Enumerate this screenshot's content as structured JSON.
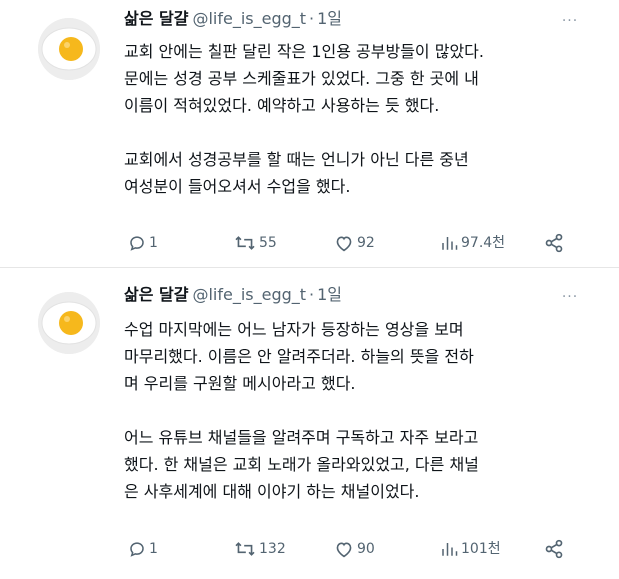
{
  "tweets": [
    {
      "display_name": "삶은 달걀",
      "handle": "@life_is_egg_t",
      "separator": "·",
      "time": "1일",
      "more_label": "···",
      "body_lines": [
        "교회 안에는 칠판 달린 작은 1인용 공부방들이 많았다.",
        "문에는 성경 공부 스케줄표가 있었다. 그중 한 곳에 내",
        "이름이 적혀있었다. 예약하고 사용하는 듯 했다.",
        "",
        "교회에서 성경공부를 할 때는 언니가 아닌 다른 중년",
        "여성분이 들어오셔서 수업을 했다."
      ],
      "stats": {
        "replies": "1",
        "retweets": "55",
        "likes": "92",
        "views": "97.4천"
      }
    },
    {
      "display_name": "삶은 달걀",
      "handle": "@life_is_egg_t",
      "separator": "·",
      "time": "1일",
      "more_label": "···",
      "body_lines": [
        "수업 마지막에는 어느 남자가 등장하는 영상을 보며",
        "마무리했다. 이름은 안 알려주더라. 하늘의 뜻을 전하",
        "며 우리를 구원할 메시아라고 했다.",
        "",
        "어느 유튜브 채널들을 알려주며 구독하고 자주 보라고",
        "했다. 한 채널은 교회 노래가 올라와있었고, 다른 채널",
        "은 사후세계에 대해 이야기 하는 채널이었다."
      ],
      "stats": {
        "replies": "1",
        "retweets": "132",
        "likes": "90",
        "views": "101천"
      }
    }
  ],
  "colors": {
    "text": "#0f1419",
    "secondary": "#536471",
    "divider": "#e6e6e6",
    "egg_white": "#ffffff",
    "egg_yolk": "#f6b81c",
    "avatar_bg": "#ededed"
  },
  "icons": [
    "reply-icon",
    "retweet-icon",
    "like-icon",
    "views-icon",
    "share-icon",
    "more-icon"
  ]
}
